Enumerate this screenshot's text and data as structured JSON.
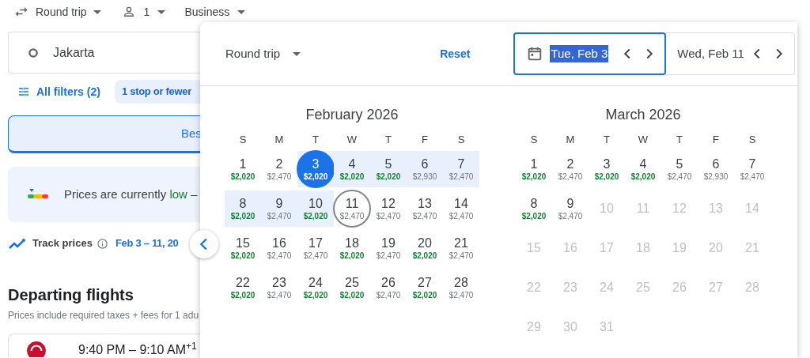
{
  "search_bar": {
    "trip_type": "Round trip",
    "passengers": "1",
    "cabin": "Business"
  },
  "origin": "Jakarta",
  "filters": {
    "all_filters": "All filters (2)",
    "chips": [
      {
        "label": "1 stop or fewer"
      }
    ]
  },
  "sort_tabs": [
    {
      "label": "Bes",
      "selected": true
    }
  ],
  "price_insight": {
    "prefix": "Prices are currently",
    "level_word": "low",
    "suffix": "–"
  },
  "track_prices": {
    "label": "Track prices",
    "dates": "Feb 3 – 11, 20"
  },
  "departing": {
    "title": "Departing flights",
    "subtitle": "Prices include required taxes + fees for 1 adu"
  },
  "flights": [
    {
      "times": "9:40 PM – 9:10 AM$^{+1}$"
    }
  ],
  "date_picker": {
    "trip_type": "Round trip",
    "reset": "Reset",
    "depart": {
      "value": "Tue, Feb 3",
      "focused": true
    },
    "return": {
      "value": "Wed, Feb 11",
      "focused": false
    },
    "months": [
      {
        "title": "February 2026",
        "weekdays": [
          "S",
          "M",
          "T",
          "W",
          "T",
          "F",
          "S"
        ],
        "days": [
          {
            "day": "1",
            "price": "$2,020",
            "cheap": true,
            "in_range": false,
            "selected": false,
            "return_date": false,
            "disabled": false
          },
          {
            "day": "2",
            "price": "$2,470",
            "cheap": false,
            "in_range": false,
            "selected": false,
            "return_date": false,
            "disabled": false
          },
          {
            "day": "3",
            "price": "$2,020",
            "cheap": true,
            "in_range": true,
            "selected": true,
            "return_date": false,
            "disabled": false
          },
          {
            "day": "4",
            "price": "$2,020",
            "cheap": true,
            "in_range": true,
            "selected": false,
            "return_date": false,
            "disabled": false
          },
          {
            "day": "5",
            "price": "$2,020",
            "cheap": true,
            "in_range": true,
            "selected": false,
            "return_date": false,
            "disabled": false
          },
          {
            "day": "6",
            "price": "$2,930",
            "cheap": false,
            "in_range": true,
            "selected": false,
            "return_date": false,
            "disabled": false
          },
          {
            "day": "7",
            "price": "$2,470",
            "cheap": false,
            "in_range": true,
            "selected": false,
            "return_date": false,
            "disabled": false
          },
          {
            "day": "8",
            "price": "$2,020",
            "cheap": true,
            "in_range": true,
            "selected": false,
            "return_date": false,
            "disabled": false
          },
          {
            "day": "9",
            "price": "$2,470",
            "cheap": false,
            "in_range": true,
            "selected": false,
            "return_date": false,
            "disabled": false
          },
          {
            "day": "10",
            "price": "$2,020",
            "cheap": true,
            "in_range": true,
            "selected": false,
            "return_date": false,
            "disabled": false
          },
          {
            "day": "11",
            "price": "$2,470",
            "cheap": false,
            "in_range": false,
            "selected": false,
            "return_date": true,
            "disabled": false
          },
          {
            "day": "12",
            "price": "$2,470",
            "cheap": false,
            "in_range": false,
            "selected": false,
            "return_date": false,
            "disabled": false
          },
          {
            "day": "13",
            "price": "$2,470",
            "cheap": false,
            "in_range": false,
            "selected": false,
            "return_date": false,
            "disabled": false
          },
          {
            "day": "14",
            "price": "$2,470",
            "cheap": false,
            "in_range": false,
            "selected": false,
            "return_date": false,
            "disabled": false
          },
          {
            "day": "15",
            "price": "$2,020",
            "cheap": true,
            "in_range": false,
            "selected": false,
            "return_date": false,
            "disabled": false
          },
          {
            "day": "16",
            "price": "$2,470",
            "cheap": false,
            "in_range": false,
            "selected": false,
            "return_date": false,
            "disabled": false
          },
          {
            "day": "17",
            "price": "$2,470",
            "cheap": false,
            "in_range": false,
            "selected": false,
            "return_date": false,
            "disabled": false
          },
          {
            "day": "18",
            "price": "$2,020",
            "cheap": true,
            "in_range": false,
            "selected": false,
            "return_date": false,
            "disabled": false
          },
          {
            "day": "19",
            "price": "$2,470",
            "cheap": false,
            "in_range": false,
            "selected": false,
            "return_date": false,
            "disabled": false
          },
          {
            "day": "20",
            "price": "$2,020",
            "cheap": true,
            "in_range": false,
            "selected": false,
            "return_date": false,
            "disabled": false
          },
          {
            "day": "21",
            "price": "$2,470",
            "cheap": false,
            "in_range": false,
            "selected": false,
            "return_date": false,
            "disabled": false
          },
          {
            "day": "22",
            "price": "$2,020",
            "cheap": true,
            "in_range": false,
            "selected": false,
            "return_date": false,
            "disabled": false
          },
          {
            "day": "23",
            "price": "$2,470",
            "cheap": false,
            "in_range": false,
            "selected": false,
            "return_date": false,
            "disabled": false
          },
          {
            "day": "24",
            "price": "$2,020",
            "cheap": true,
            "in_range": false,
            "selected": false,
            "return_date": false,
            "disabled": false
          },
          {
            "day": "25",
            "price": "$2,020",
            "cheap": true,
            "in_range": false,
            "selected": false,
            "return_date": false,
            "disabled": false
          },
          {
            "day": "26",
            "price": "$2,470",
            "cheap": false,
            "in_range": false,
            "selected": false,
            "return_date": false,
            "disabled": false
          },
          {
            "day": "27",
            "price": "$2,020",
            "cheap": true,
            "in_range": false,
            "selected": false,
            "return_date": false,
            "disabled": false
          },
          {
            "day": "28",
            "price": "$2,470",
            "cheap": false,
            "in_range": false,
            "selected": false,
            "return_date": false,
            "disabled": false
          }
        ]
      },
      {
        "title": "March 2026",
        "weekdays": [
          "S",
          "M",
          "T",
          "W",
          "T",
          "F",
          "S"
        ],
        "days": [
          {
            "day": "1",
            "price": "$2,020",
            "cheap": true,
            "in_range": false,
            "selected": false,
            "return_date": false,
            "disabled": false
          },
          {
            "day": "2",
            "price": "$2,470",
            "cheap": false,
            "in_range": false,
            "selected": false,
            "return_date": false,
            "disabled": false
          },
          {
            "day": "3",
            "price": "$2,020",
            "cheap": true,
            "in_range": false,
            "selected": false,
            "return_date": false,
            "disabled": false
          },
          {
            "day": "4",
            "price": "$2,020",
            "cheap": true,
            "in_range": false,
            "selected": false,
            "return_date": false,
            "disabled": false
          },
          {
            "day": "5",
            "price": "$2,470",
            "cheap": false,
            "in_range": false,
            "selected": false,
            "return_date": false,
            "disabled": false
          },
          {
            "day": "6",
            "price": "$2,930",
            "cheap": false,
            "in_range": false,
            "selected": false,
            "return_date": false,
            "disabled": false
          },
          {
            "day": "7",
            "price": "$2,470",
            "cheap": false,
            "in_range": false,
            "selected": false,
            "return_date": false,
            "disabled": false
          },
          {
            "day": "8",
            "price": "$2,020",
            "cheap": true,
            "in_range": false,
            "selected": false,
            "return_date": false,
            "disabled": false
          },
          {
            "day": "9",
            "price": "$2,470",
            "cheap": false,
            "in_range": false,
            "selected": false,
            "return_date": false,
            "disabled": false
          },
          {
            "day": "10",
            "cheap": false,
            "in_range": false,
            "selected": false,
            "return_date": false,
            "disabled": true
          },
          {
            "day": "11",
            "cheap": false,
            "in_range": false,
            "selected": false,
            "return_date": false,
            "disabled": true
          },
          {
            "day": "12",
            "cheap": false,
            "in_range": false,
            "selected": false,
            "return_date": false,
            "disabled": true
          },
          {
            "day": "13",
            "cheap": false,
            "in_range": false,
            "selected": false,
            "return_date": false,
            "disabled": true
          },
          {
            "day": "14",
            "cheap": false,
            "in_range": false,
            "selected": false,
            "return_date": false,
            "disabled": true
          },
          {
            "day": "15",
            "cheap": false,
            "in_range": false,
            "selected": false,
            "return_date": false,
            "disabled": true
          },
          {
            "day": "16",
            "cheap": false,
            "in_range": false,
            "selected": false,
            "return_date": false,
            "disabled": true
          },
          {
            "day": "17",
            "cheap": false,
            "in_range": false,
            "selected": false,
            "return_date": false,
            "disabled": true
          },
          {
            "day": "18",
            "cheap": false,
            "in_range": false,
            "selected": false,
            "return_date": false,
            "disabled": true
          },
          {
            "day": "19",
            "cheap": false,
            "in_range": false,
            "selected": false,
            "return_date": false,
            "disabled": true
          },
          {
            "day": "20",
            "cheap": false,
            "in_range": false,
            "selected": false,
            "return_date": false,
            "disabled": true
          },
          {
            "day": "21",
            "cheap": false,
            "in_range": false,
            "selected": false,
            "return_date": false,
            "disabled": true
          },
          {
            "day": "22",
            "cheap": false,
            "in_range": false,
            "selected": false,
            "return_date": false,
            "disabled": true
          },
          {
            "day": "23",
            "cheap": false,
            "in_range": false,
            "selected": false,
            "return_date": false,
            "disabled": true
          },
          {
            "day": "24",
            "cheap": false,
            "in_range": false,
            "selected": false,
            "return_date": false,
            "disabled": true
          },
          {
            "day": "25",
            "cheap": false,
            "in_range": false,
            "selected": false,
            "return_date": false,
            "disabled": true
          },
          {
            "day": "26",
            "cheap": false,
            "in_range": false,
            "selected": false,
            "return_date": false,
            "disabled": true
          },
          {
            "day": "27",
            "cheap": false,
            "in_range": false,
            "selected": false,
            "return_date": false,
            "disabled": true
          },
          {
            "day": "28",
            "cheap": false,
            "in_range": false,
            "selected": false,
            "return_date": false,
            "disabled": true
          },
          {
            "day": "29",
            "cheap": false,
            "in_range": false,
            "selected": false,
            "return_date": false,
            "disabled": true
          },
          {
            "day": "30",
            "cheap": false,
            "in_range": false,
            "selected": false,
            "return_date": false,
            "disabled": true
          },
          {
            "day": "31",
            "cheap": false,
            "in_range": false,
            "selected": false,
            "return_date": false,
            "disabled": true
          }
        ]
      }
    ]
  }
}
